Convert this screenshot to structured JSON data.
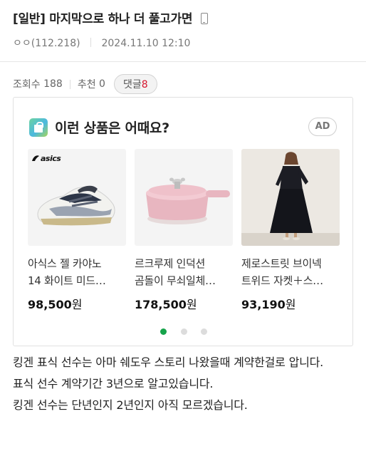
{
  "post": {
    "category": "[일반]",
    "title": "마지막으로 하나 더 풀고가면",
    "author": "ㅇㅇ(112.218)",
    "datetime": "2024.11.10 12:10"
  },
  "stats": {
    "views_label": "조회수",
    "views": "188",
    "recommend_label": "추천",
    "recommend": "0",
    "comment_label": "댓글",
    "comment_count": "8"
  },
  "ad": {
    "heading": "이런 상품은 어때요?",
    "badge": "AD",
    "products": [
      {
        "line1": "아식스 젤 카야노",
        "line2": "14 화이트 미드…",
        "price": "98,500",
        "unit": "원",
        "brand_mark": "asics"
      },
      {
        "line1": "르크루제 인덕션",
        "line2": "곰돌이 무쇠일체…",
        "price": "178,500",
        "unit": "원"
      },
      {
        "line1": "제로스트릿 브이넥",
        "line2": "트위드 자켓＋스…",
        "price": "93,190",
        "unit": "원"
      }
    ],
    "carousel_active_index": 0,
    "carousel_pages": 3,
    "accent_color": "#16a34a"
  },
  "body": {
    "lines": [
      "킹겐 표식 선수는 아마 쉐도우 스토리 나왔을때 계약한걸로 압니다.",
      "표식 선수 계약기간 3년으로 알고있습니다.",
      "킹겐 선수는 단년인지 2년인지 아직 모르겠습니다."
    ]
  }
}
